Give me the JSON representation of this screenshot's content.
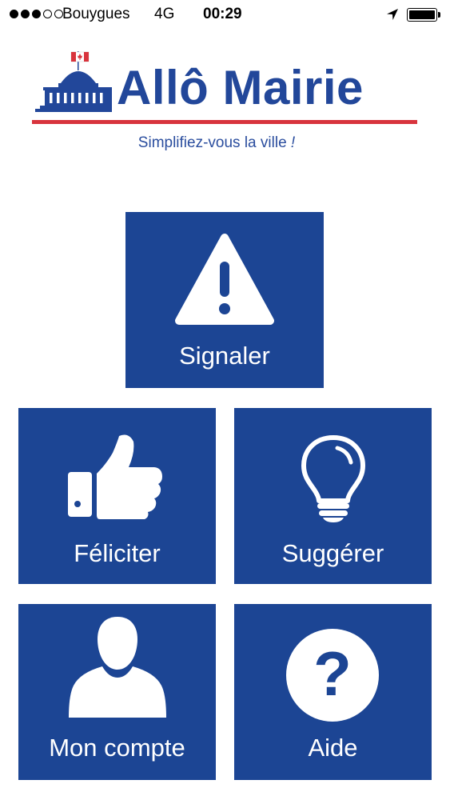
{
  "status_bar": {
    "carrier": "Bouygues",
    "network": "4G",
    "time": "00:29",
    "signal_bars_filled": 3,
    "signal_bars_total": 5,
    "battery_level": 1.0
  },
  "header": {
    "title": "Allô Mairie",
    "tagline": "Simplifiez-vous la ville",
    "tagline_punctuation": "!",
    "brand_color": "#22479a",
    "accent_color": "#d8343d"
  },
  "tiles": [
    {
      "id": "signaler",
      "label": "Signaler",
      "icon": "warning-icon"
    },
    {
      "id": "feliciter",
      "label": "Féliciter",
      "icon": "thumbs-up-icon"
    },
    {
      "id": "suggerer",
      "label": "Suggérer",
      "icon": "lightbulb-icon"
    },
    {
      "id": "compte",
      "label": "Mon compte",
      "icon": "user-icon"
    },
    {
      "id": "aide",
      "label": "Aide",
      "icon": "help-icon"
    }
  ],
  "tile_color": "#1c4594"
}
